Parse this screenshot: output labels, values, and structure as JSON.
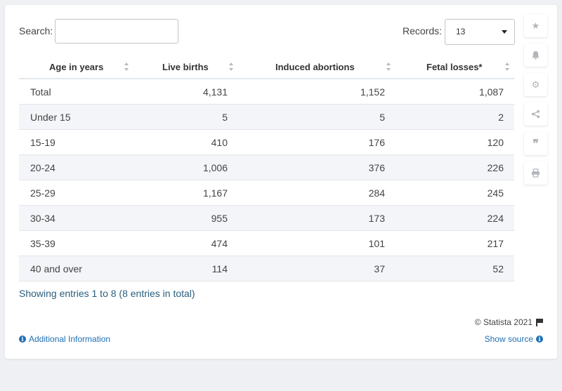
{
  "search": {
    "label": "Search:",
    "value": "",
    "placeholder": ""
  },
  "records": {
    "label": "Records:",
    "value": "13"
  },
  "table": {
    "headers": [
      "Age in years",
      "Live births",
      "Induced abortions",
      "Fetal losses*"
    ],
    "rows": [
      [
        "Total",
        "4,131",
        "1,152",
        "1,087"
      ],
      [
        "Under 15",
        "5",
        "5",
        "2"
      ],
      [
        "15-19",
        "410",
        "176",
        "120"
      ],
      [
        "20-24",
        "1,006",
        "376",
        "226"
      ],
      [
        "25-29",
        "1,167",
        "284",
        "245"
      ],
      [
        "30-34",
        "955",
        "173",
        "224"
      ],
      [
        "35-39",
        "474",
        "101",
        "217"
      ],
      [
        "40 and over",
        "114",
        "37",
        "52"
      ]
    ]
  },
  "footer": {
    "entries": "Showing entries 1 to 8 (8 entries in total)",
    "copyright": "© Statista 2021",
    "additional_info": "Additional Information",
    "show_source": "Show source"
  },
  "side_icons": [
    "star-icon",
    "bell-icon",
    "gear-icon",
    "share-icon",
    "quote-icon",
    "print-icon"
  ],
  "colors": {
    "link": "#1f6fb5",
    "alt_row": "#f3f5f8",
    "background": "#eef0f3"
  }
}
